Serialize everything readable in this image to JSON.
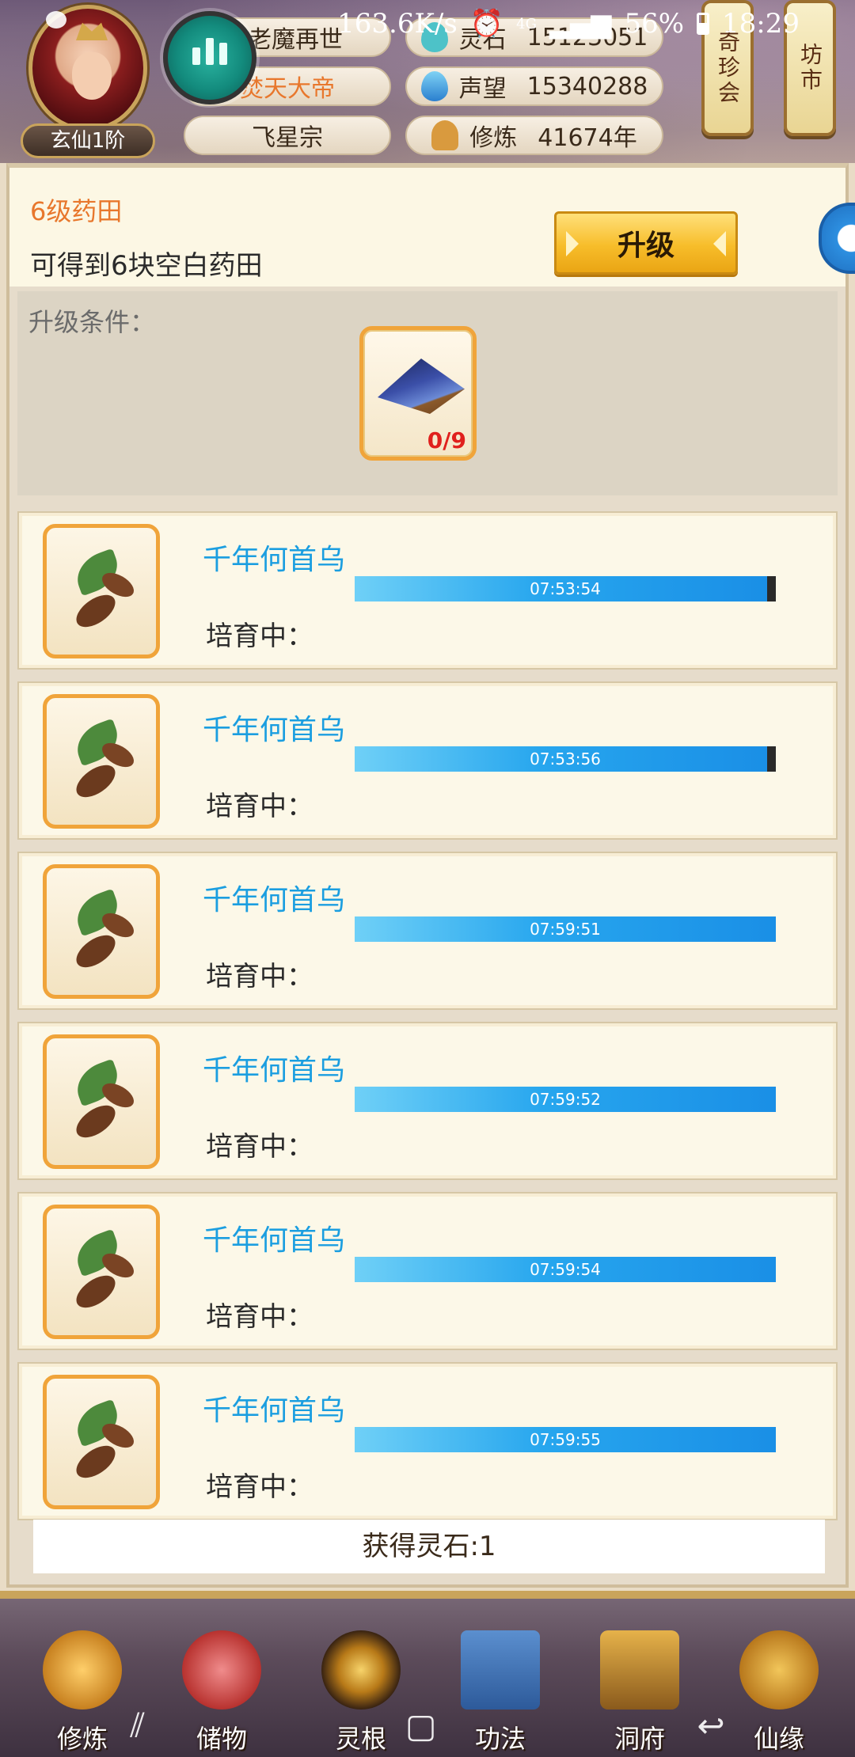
{
  "status_bar": {
    "net_speed": "163.6K/s",
    "network": "4G",
    "battery": "56%",
    "time": "18:29"
  },
  "player": {
    "rank": "玄仙1阶",
    "name_partial": "老魔再世",
    "title": "焚天大帝",
    "sect": "飞星宗"
  },
  "resources": {
    "lingshi_label": "灵石",
    "lingshi_value": "15123051",
    "prestige_label": "声望",
    "prestige_value": "15340288",
    "cultivation_label": "修炼",
    "cultivation_value": "41674年"
  },
  "top_buttons": {
    "treasure_fair": "奇珍会",
    "market": "坊市"
  },
  "farm": {
    "level_title": "6级药田",
    "description": "可得到6块空白药田",
    "upgrade_label": "升级",
    "condition_label": "升级条件：",
    "required_item_count": "0/9"
  },
  "plots": [
    {
      "herb": "千年何首乌",
      "status": "培育中：",
      "timer": "07:53:54",
      "progress": 0.98
    },
    {
      "herb": "千年何首乌",
      "status": "培育中：",
      "timer": "07:53:56",
      "progress": 0.98
    },
    {
      "herb": "千年何首乌",
      "status": "培育中：",
      "timer": "07:59:51",
      "progress": 1.0
    },
    {
      "herb": "千年何首乌",
      "status": "培育中：",
      "timer": "07:59:52",
      "progress": 1.0
    },
    {
      "herb": "千年何首乌",
      "status": "培育中：",
      "timer": "07:59:54",
      "progress": 1.0
    },
    {
      "herb": "千年何首乌",
      "status": "培育中：",
      "timer": "07:59:55",
      "progress": 1.0
    }
  ],
  "reward_text": "获得灵石:1",
  "bottom_nav": [
    {
      "label": "修炼",
      "icon": "meditating-monk-icon"
    },
    {
      "label": "储物",
      "icon": "storage-bag-icon"
    },
    {
      "label": "灵根",
      "icon": "spirit-root-icon"
    },
    {
      "label": "功法",
      "icon": "scripture-book-icon"
    },
    {
      "label": "洞府",
      "icon": "cave-palace-icon"
    },
    {
      "label": "仙缘",
      "icon": "gourd-icon"
    }
  ],
  "colors": {
    "accent_orange": "#e8772c",
    "herb_blue": "#1b9ee0",
    "progress_blue": "#1a8fe6",
    "button_gold": "#f7bd2a",
    "slot_border": "#f0a43a",
    "count_red": "#e0201d"
  }
}
